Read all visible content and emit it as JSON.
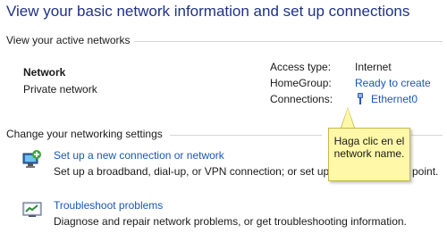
{
  "page": {
    "title": "View your basic network information and set up connections"
  },
  "active_networks": {
    "header": "View your active networks",
    "network": {
      "name": "Network",
      "type": "Private network",
      "access_type_label": "Access type:",
      "access_type_value": "Internet",
      "homegroup_label": "HomeGroup:",
      "homegroup_value": "Ready to create",
      "connections_label": "Connections:",
      "connections_value": "Ethernet0",
      "connections_icon": "ethernet-icon"
    }
  },
  "settings": {
    "header": "Change your networking settings",
    "tasks": [
      {
        "title": "Set up a new connection or network",
        "desc": "Set up a broadband, dial-up, or VPN connection; or set up a",
        "icon": "new-connection-icon"
      },
      {
        "title": "Troubleshoot problems",
        "desc": "Diagnose and repair network problems, or get troubleshooting information.",
        "icon": "troubleshoot-icon"
      }
    ],
    "desc_overflow": "point."
  },
  "tooltip": {
    "text": "Haga clic en el network name."
  },
  "colors": {
    "title": "#1e3287",
    "link": "#1a56b8",
    "tooltip_bg": "#fff8a8"
  }
}
